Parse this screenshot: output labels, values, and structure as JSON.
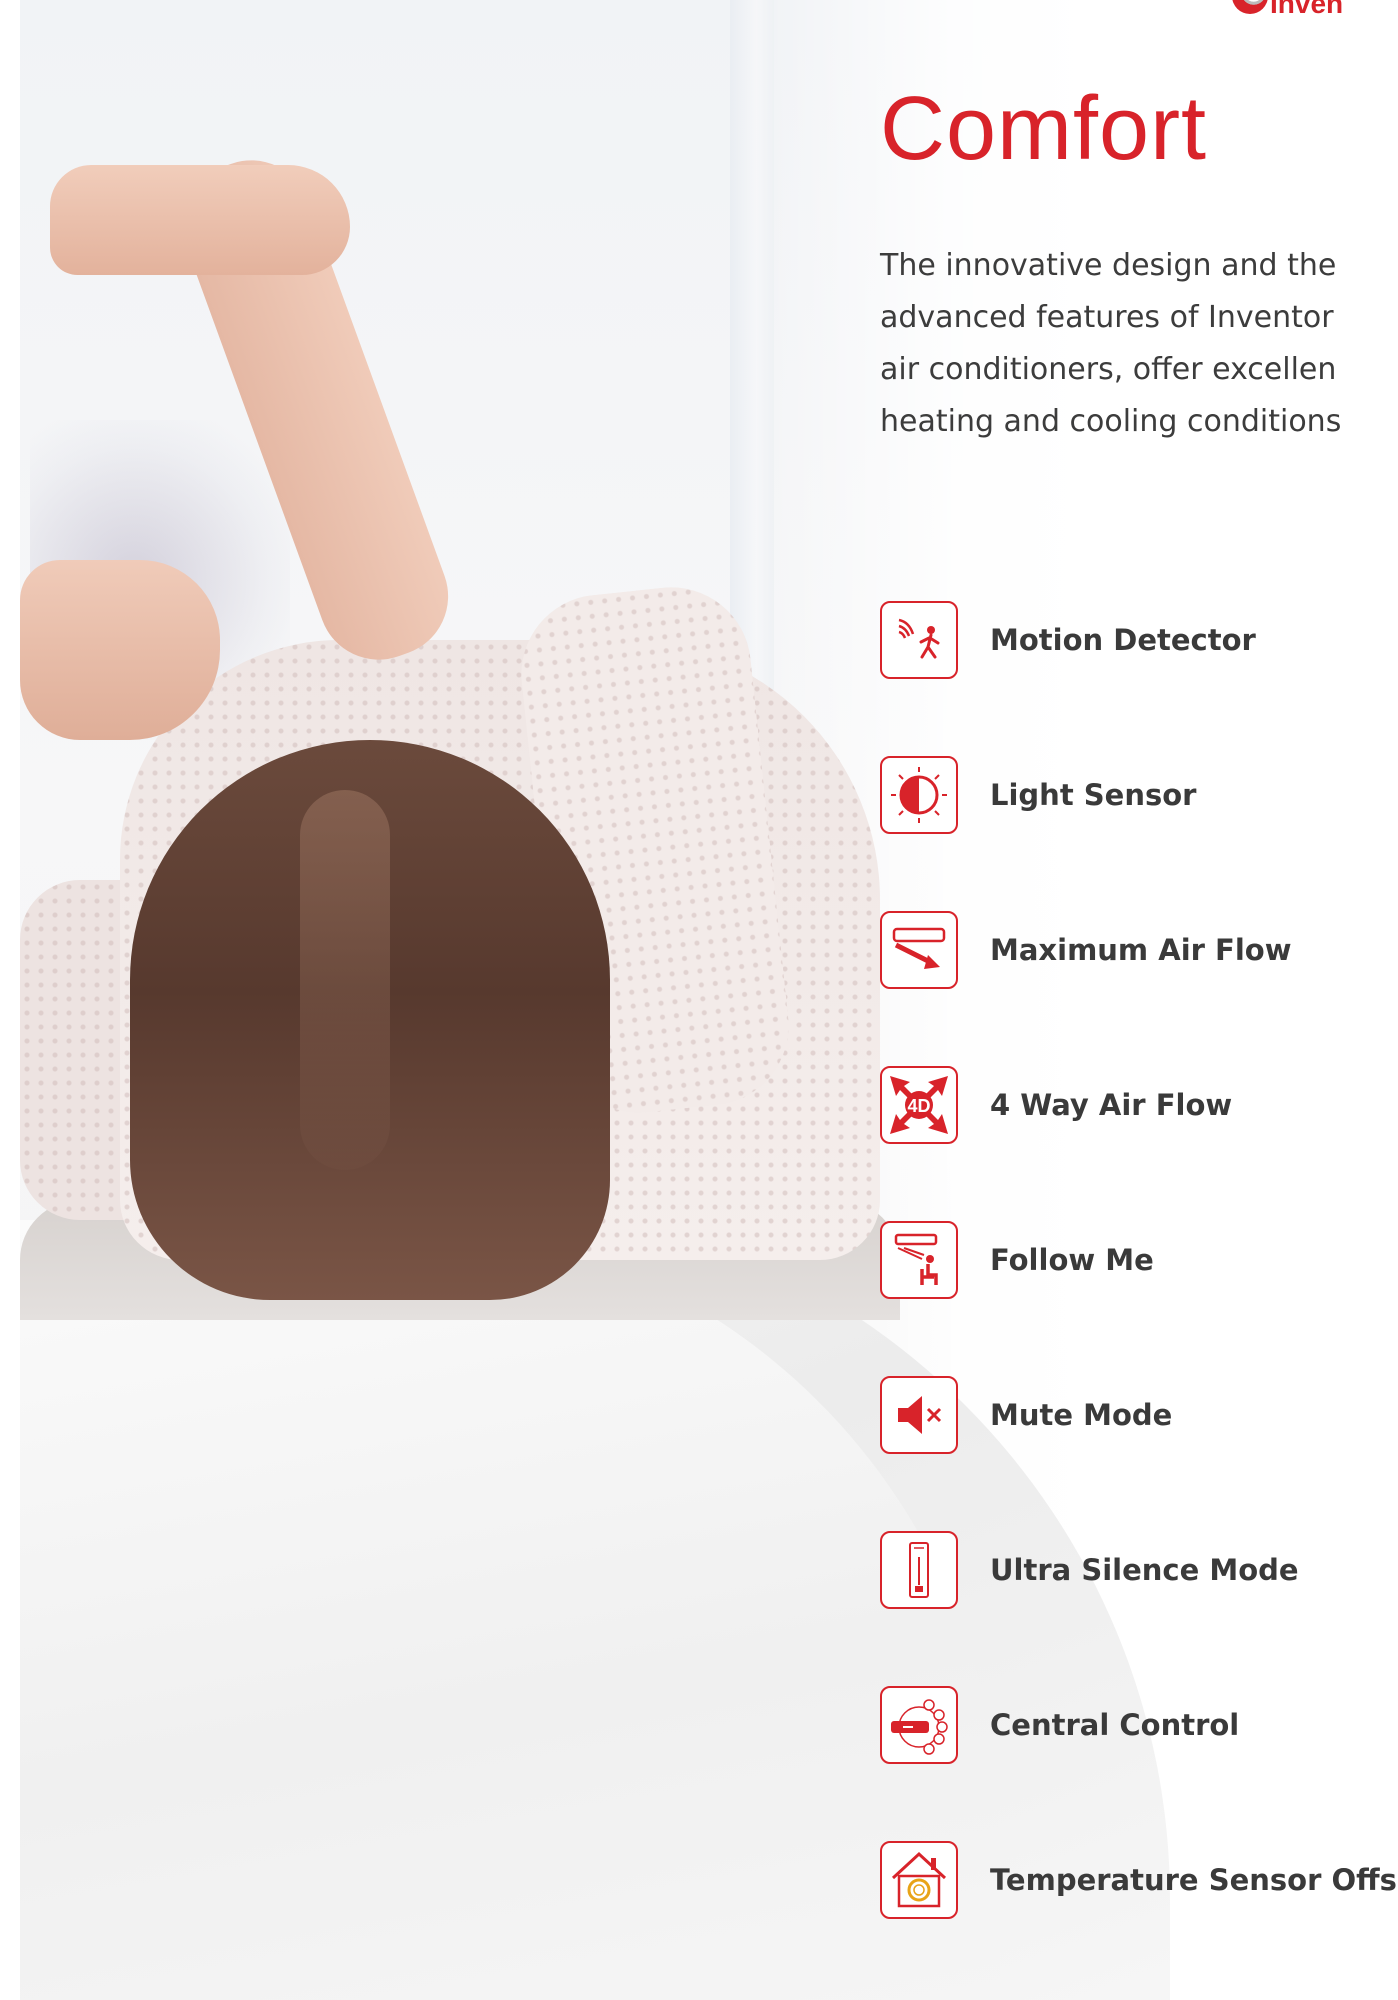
{
  "logo": {
    "text": "Inven",
    "icon": "brand-logo-icon"
  },
  "title": "Comfort",
  "intro": "The innovative design and the\nadvanced features of Inventor\nair conditioners, offer excellen\nheating and cooling conditions",
  "features": [
    {
      "label": "Motion Detector",
      "icon": "motion-detector-icon"
    },
    {
      "label": "Light Sensor",
      "icon": "light-sensor-icon"
    },
    {
      "label": "Maximum Air Flow",
      "icon": "max-air-flow-icon"
    },
    {
      "label": "4 Way Air Flow",
      "icon": "four-way-air-flow-icon",
      "icon_text": "4D"
    },
    {
      "label": "Follow Me",
      "icon": "follow-me-icon"
    },
    {
      "label": "Mute Mode",
      "icon": "mute-icon"
    },
    {
      "label": "Ultra Silence Mode",
      "icon": "ultra-silence-icon"
    },
    {
      "label": "Central Control",
      "icon": "central-control-icon"
    },
    {
      "label": "Temperature Sensor Offse",
      "icon": "temperature-sensor-offset-icon"
    }
  ],
  "colors": {
    "accent": "#d8232a",
    "text": "#3a3a3a"
  }
}
